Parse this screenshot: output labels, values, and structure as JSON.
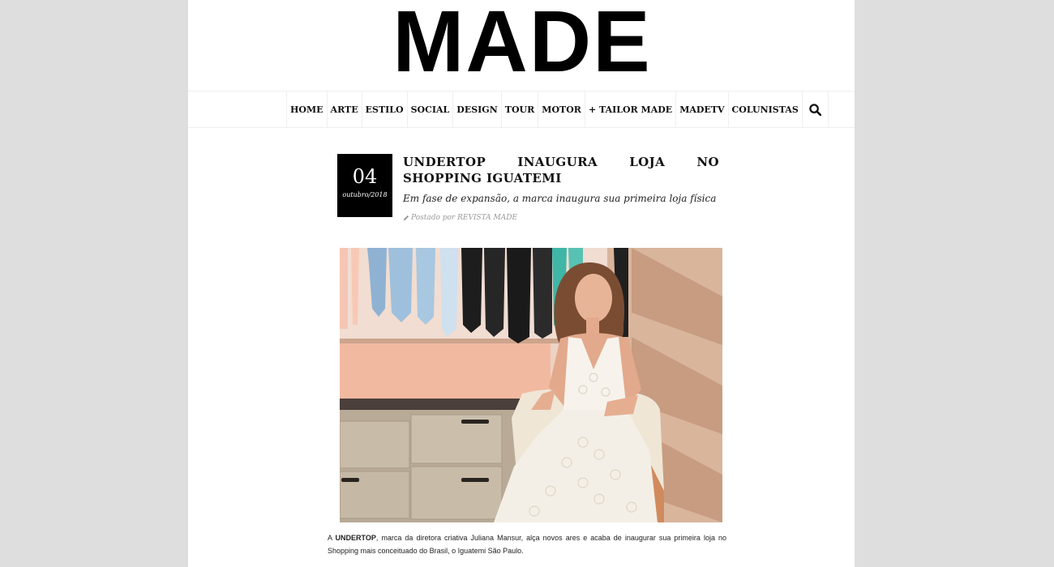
{
  "site": {
    "logo_text": "MADE"
  },
  "nav": {
    "items": [
      "HOME",
      "ARTE",
      "ESTILO",
      "SOCIAL",
      "DESIGN",
      "TOUR",
      "MOTOR",
      "+ TAILOR MADE",
      "MADETV",
      "COLUNISTAS"
    ],
    "search_icon": "search-icon"
  },
  "article": {
    "date_day": "04",
    "date_month": "outubro/2018",
    "title": "UNDERTOP INAUGURA LOJA NO SHOPPING IGUATEMI",
    "subtitle": "Em fase de expansão, a marca inaugura sua primeira loja física",
    "byline_icon": "pencil-icon",
    "byline": "Postado por REVISTA MADE",
    "body_prefix": "A ",
    "body_bold": "UNDERTOP",
    "body_rest": ", marca da diretora criativa Juliana Mansur, alça novos ares e acaba de inaugurar sua primeira loja no Shopping mais conceituado do Brasil, o Iguatemi São Paulo."
  },
  "colors": {
    "page_background": "#dedede",
    "content_background": "#ffffff",
    "date_box": "#000000"
  }
}
